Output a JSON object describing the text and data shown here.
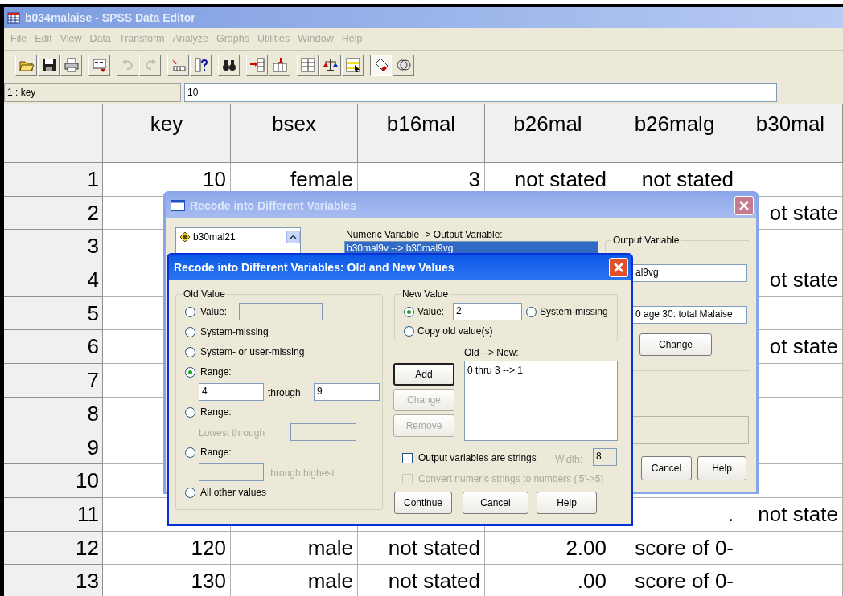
{
  "window": {
    "title": "b034malaise - SPSS Data Editor"
  },
  "menu": [
    {
      "label": "File",
      "disabled": true
    },
    {
      "label": "Edit",
      "disabled": true
    },
    {
      "label": "View",
      "disabled": true
    },
    {
      "label": "Data",
      "disabled": true
    },
    {
      "label": "Transform",
      "disabled": true
    },
    {
      "label": "Analyze",
      "disabled": true
    },
    {
      "label": "Graphs",
      "disabled": true
    },
    {
      "label": "Utilities",
      "disabled": true
    },
    {
      "label": "Window",
      "disabled": true
    },
    {
      "label": "Help",
      "disabled": true
    }
  ],
  "toolbar": [
    {
      "kind": "open",
      "disabled": false,
      "pressed": false
    },
    {
      "kind": "save",
      "disabled": false,
      "pressed": false
    },
    {
      "kind": "print",
      "disabled": false,
      "pressed": false
    },
    {
      "kind": "recall",
      "disabled": false,
      "pressed": false
    },
    {
      "kind": "undo",
      "disabled": true,
      "pressed": false
    },
    {
      "kind": "redo",
      "disabled": true,
      "pressed": false
    },
    {
      "kind": "goto",
      "disabled": false,
      "pressed": false
    },
    {
      "kind": "variables",
      "disabled": false,
      "pressed": false
    },
    {
      "kind": "find",
      "disabled": false,
      "pressed": false
    },
    {
      "kind": "insert_cases",
      "disabled": false,
      "pressed": false
    },
    {
      "kind": "insert_variable",
      "disabled": false,
      "pressed": false
    },
    {
      "kind": "split",
      "disabled": false,
      "pressed": false
    },
    {
      "kind": "weight",
      "disabled": false,
      "pressed": false
    },
    {
      "kind": "select",
      "disabled": false,
      "pressed": false
    },
    {
      "kind": "labels",
      "disabled": false,
      "pressed": true
    },
    {
      "kind": "sets",
      "disabled": false,
      "pressed": false
    }
  ],
  "cell_editor": {
    "cell": "1 : key",
    "value": "10"
  },
  "grid": {
    "columns": [
      "key",
      "bsex",
      "b16mal",
      "b26mal",
      "b26malg",
      "b30mal"
    ],
    "rows": [
      {
        "number": "1",
        "cells": [
          "10",
          "female",
          "3",
          "not stated",
          "not stated",
          null
        ]
      },
      {
        "number": "2",
        "cells": [
          null,
          null,
          null,
          null,
          null,
          "ot state"
        ]
      },
      {
        "number": "3",
        "cells": [
          null,
          null,
          null,
          null,
          null,
          null
        ]
      },
      {
        "number": "4",
        "cells": [
          null,
          null,
          null,
          null,
          null,
          "ot state"
        ]
      },
      {
        "number": "5",
        "cells": [
          null,
          null,
          null,
          null,
          null,
          null
        ]
      },
      {
        "number": "6",
        "cells": [
          null,
          null,
          null,
          null,
          null,
          "ot state"
        ]
      },
      {
        "number": "7",
        "cells": [
          null,
          null,
          null,
          null,
          null,
          null
        ]
      },
      {
        "number": "8",
        "cells": [
          null,
          null,
          null,
          null,
          null,
          null
        ]
      },
      {
        "number": "9",
        "cells": [
          null,
          null,
          null,
          null,
          null,
          null
        ]
      },
      {
        "number": "10",
        "cells": [
          null,
          null,
          null,
          null,
          null,
          null
        ]
      },
      {
        "number": "11",
        "cells": [
          null,
          null,
          null,
          null,
          ".",
          "not state"
        ]
      },
      {
        "number": "12",
        "cells": [
          "120",
          "male",
          "not stated",
          "2.00",
          "score of 0-",
          null
        ]
      },
      {
        "number": "13",
        "cells": [
          "130",
          "male",
          "not stated",
          ".00",
          "score of 0-",
          null
        ]
      }
    ]
  },
  "dialog": {
    "title": "Recode into Different Variables",
    "active": false,
    "variable_list": [
      "b30mal21"
    ],
    "mapping_label": "Numeric Variable -> Output Variable:",
    "mapping_list": [
      {
        "text": "b30mal9v --> b30mal9vg",
        "selected": true
      }
    ],
    "output_variable": {
      "title": "Output Variable",
      "name_value": "al9vg",
      "label_value": "0 age 30: total Malaise",
      "button": "Change"
    },
    "buttons": [
      "Cancel",
      "Help"
    ]
  },
  "subdialog": {
    "title": "Recode into Different Variables: Old and New Values",
    "active": true,
    "old_value": {
      "title": "Old Value",
      "options": [
        {
          "kind": "value",
          "label": "Value:",
          "selected": false
        },
        {
          "kind": "plain",
          "label": "System-missing",
          "selected": false
        },
        {
          "kind": "plain",
          "label": "System- or user-missing",
          "selected": false
        },
        {
          "kind": "range",
          "label": "Range:",
          "selected": true,
          "from": "4",
          "through": "through",
          "to": "9"
        },
        {
          "kind": "lowest",
          "label": "Range:",
          "selected": false,
          "hint": "Lowest through"
        },
        {
          "kind": "highest",
          "label": "Range:",
          "selected": false,
          "hint": "through highest"
        },
        {
          "kind": "plain",
          "label": "All other values",
          "selected": false
        }
      ]
    },
    "new_value": {
      "title": "New Value",
      "options": [
        {
          "kind": "value",
          "label": "Value:",
          "selected": true,
          "value": "2"
        },
        {
          "kind": "plain",
          "label": "System-missing",
          "selected": false
        },
        {
          "kind": "plain",
          "label": "Copy old value(s)",
          "selected": false
        }
      ]
    },
    "list_label": "Old --> New:",
    "list": [
      "0 thru 3 --> 1"
    ],
    "side_buttons": [
      {
        "label": "Add",
        "disabled": false
      },
      {
        "label": "Change",
        "disabled": true
      },
      {
        "label": "Remove",
        "disabled": true
      }
    ],
    "checkboxes": [
      {
        "label": "Output variables are strings",
        "checked": false,
        "disabled": false,
        "width_label": "Width:",
        "width_value": "8"
      },
      {
        "label": "Convert numeric strings to numbers ('5'->5)",
        "checked": false,
        "disabled": true
      }
    ],
    "buttons": [
      "Continue",
      "Cancel",
      "Help"
    ]
  }
}
